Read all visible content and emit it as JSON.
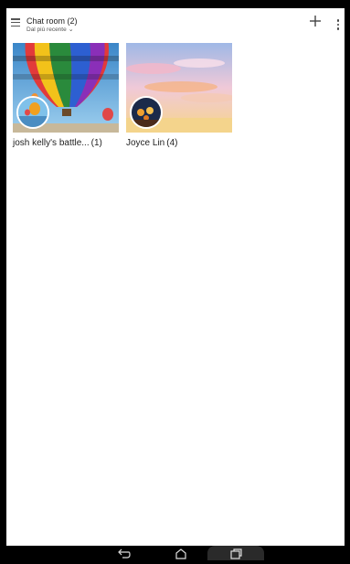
{
  "header": {
    "title": "Chat room (2)",
    "sort_label": "Dal più recente",
    "menu_icon": "hamburger-menu-icon",
    "add_icon": "plus-icon",
    "more_icon": "overflow-menu-icon"
  },
  "albums": [
    {
      "name": "josh kelly's battle...",
      "count": "(1)",
      "thumbnail": "hot-air-balloon-photo",
      "avatar": "balloon-avatar"
    },
    {
      "name": "Joyce Lin",
      "count": "(4)",
      "thumbnail": "sunset-sky-photo",
      "avatar": "lantern-avatar"
    }
  ],
  "navbar": {
    "back_icon": "back-icon",
    "home_icon": "home-icon",
    "recents_icon": "recents-icon"
  },
  "colors": {
    "background": "#ffffff",
    "navbar": "#000000",
    "text": "#222222"
  }
}
